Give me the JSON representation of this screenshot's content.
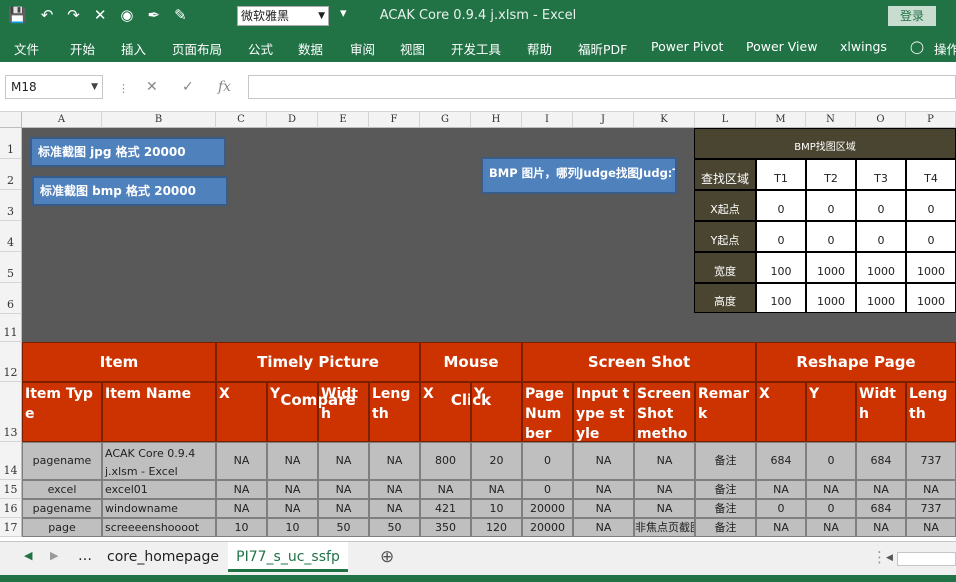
{
  "window": {
    "title": "ACAK Core 0.9.4 j.xlsm  -  Excel",
    "login_label": "登录"
  },
  "qat": {
    "font_name": "微软雅黑"
  },
  "ribbon": {
    "tabs": [
      "文件",
      "开始",
      "插入",
      "页面布局",
      "公式",
      "数据",
      "审阅",
      "视图",
      "开发工具",
      "帮助",
      "福昕PDF",
      "Power Pivot",
      "Power View",
      "xlwings",
      "操作"
    ]
  },
  "formula_bar": {
    "name_box": "M18",
    "value": ""
  },
  "columns": [
    "A",
    "B",
    "C",
    "D",
    "E",
    "F",
    "G",
    "H",
    "I",
    "J",
    "K",
    "L",
    "M",
    "N",
    "O",
    "P"
  ],
  "rows": [
    "1",
    "2",
    "3",
    "4",
    "5",
    "6",
    "11",
    "12",
    "13",
    "14",
    "15",
    "16",
    "17"
  ],
  "buttons": {
    "jpg": "标准截图 jpg 格式 20000",
    "bmp": "标准截图 bmp 格式 20000",
    "bmp_find": "BMP 图片，哪列Judge找图Judg:T"
  },
  "bmp_table": {
    "title": "BMP找图区域",
    "header": [
      "查找区域",
      "T1",
      "T2",
      "T3",
      "T4"
    ],
    "rows": [
      [
        "X起点",
        "0",
        "0",
        "0",
        "0"
      ],
      [
        "Y起点",
        "0",
        "0",
        "0",
        "0"
      ],
      [
        "宽度",
        "100",
        "1000",
        "1000",
        "1000"
      ],
      [
        "高度",
        "100",
        "1000",
        "1000",
        "1000"
      ]
    ]
  },
  "groups": [
    "Item",
    "Timely Picture Compare",
    "Mouse Click",
    "Screen Shot",
    "Reshape Page"
  ],
  "subheaders": [
    "Item Type",
    "Item Name",
    "X",
    "Y",
    "Width",
    "Length",
    "X",
    "Y",
    "Page Number",
    "Input type style",
    "ScreenShot metho",
    "Remark",
    "X",
    "Y",
    "Width",
    "Length"
  ],
  "data_rows": [
    [
      "pagename",
      "ACAK Core 0.9.4 j.xlsm - Excel",
      "NA",
      "NA",
      "NA",
      "NA",
      "800",
      "20",
      "0",
      "NA",
      "NA",
      "备注",
      "684",
      "0",
      "684",
      "737"
    ],
    [
      "excel",
      "excel01",
      "NA",
      "NA",
      "NA",
      "NA",
      "NA",
      "NA",
      "0",
      "NA",
      "NA",
      "备注",
      "NA",
      "NA",
      "NA",
      "NA"
    ],
    [
      "pagename",
      "windowname",
      "NA",
      "NA",
      "NA",
      "NA",
      "421",
      "10",
      "20000",
      "NA",
      "NA",
      "备注",
      "0",
      "0",
      "684",
      "737"
    ],
    [
      "page",
      "screeeenshoooot",
      "10",
      "10",
      "50",
      "50",
      "350",
      "120",
      "20000",
      "NA",
      "非焦点页截图",
      "备注",
      "NA",
      "NA",
      "NA",
      "NA"
    ]
  ],
  "sheet_tabs": [
    "core_homepage",
    "PI77_s_uc_ssfp"
  ],
  "colors": {
    "excel_green": "#217346",
    "header_red": "#cc3300",
    "button_blue": "#4f81bd",
    "dark_zone": "#595959"
  }
}
